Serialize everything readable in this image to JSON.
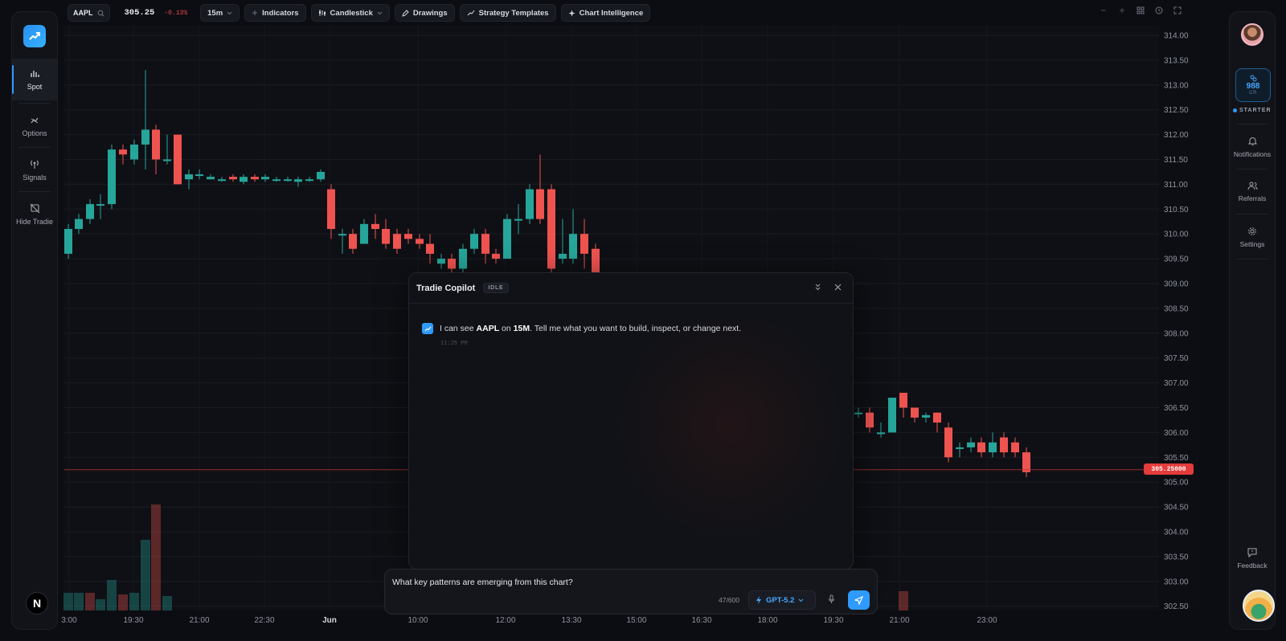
{
  "toolbar": {
    "ticker": "AAPL",
    "price": "305.25",
    "change": "-0.13%",
    "interval": "15m",
    "indicators_label": "Indicators",
    "chart_type_label": "Candlestick",
    "drawings_label": "Drawings",
    "strategy_label": "Strategy Templates",
    "intelligence_label": "Chart Intelligence"
  },
  "left_nav": {
    "items": [
      {
        "label": "Spot",
        "icon": "bar-chart-icon"
      },
      {
        "label": "Options",
        "icon": "options-icon"
      },
      {
        "label": "Signals",
        "icon": "signal-icon"
      },
      {
        "label": "Hide Tradie",
        "icon": "hide-icon"
      }
    ],
    "badge": "N"
  },
  "right_nav": {
    "credits_value": "988",
    "credits_unit": "CR",
    "plan": "STARTER",
    "items": [
      {
        "label": "Notifications",
        "icon": "bell-icon"
      },
      {
        "label": "Referrals",
        "icon": "users-icon"
      },
      {
        "label": "Settings",
        "icon": "gear-icon"
      }
    ],
    "feedback_label": "Feedback"
  },
  "chart": {
    "price_axis": [
      "314.00",
      "313.50",
      "313.00",
      "312.50",
      "312.00",
      "311.50",
      "311.00",
      "310.50",
      "310.00",
      "309.50",
      "309.00",
      "308.50",
      "308.00",
      "307.50",
      "307.00",
      "306.50",
      "306.00",
      "305.50",
      "305.00",
      "304.50",
      "304.00",
      "303.50",
      "303.00",
      "302.50"
    ],
    "time_axis": [
      "3:00",
      "19:30",
      "21:00",
      "22:30",
      "Jun",
      "10:00",
      "12:00",
      "13:30",
      "15:00",
      "16:30",
      "18:00",
      "19:30",
      "21:00",
      "23:00"
    ],
    "last_price_label": "305.25000",
    "up_color": "#26a69a",
    "down_color": "#ef5350"
  },
  "copilot": {
    "title": "Tradie Copilot",
    "status": "IDLE",
    "message_prefix": "I can see ",
    "message_ticker": "AAPL",
    "message_mid": " on ",
    "message_interval": "15M",
    "message_suffix": ". Tell me what you want to build, inspect, or change next.",
    "message_time": "11:25 PM"
  },
  "composer": {
    "value": "What key patterns are emerging from this chart?",
    "counter": "47/600",
    "model": "GPT-5.2"
  }
}
